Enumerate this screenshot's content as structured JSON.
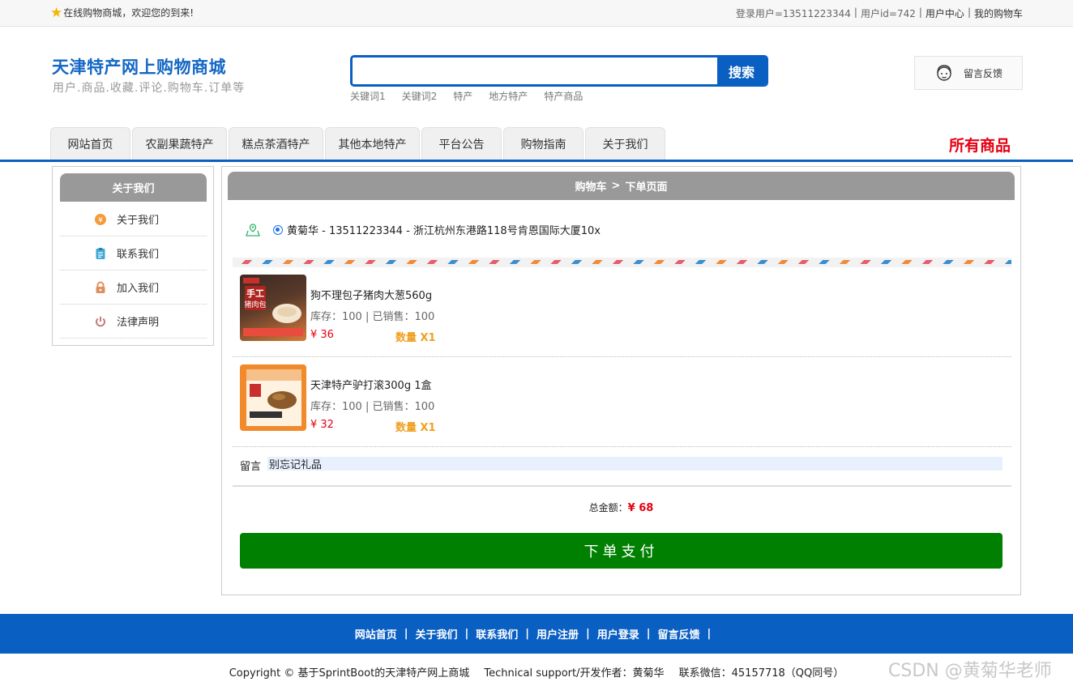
{
  "topbar": {
    "welcome": "在线购物商城，欢迎您的到来!",
    "login_user": "登录用户=13511223344",
    "user_id": "用户id=742",
    "user_center": "用户中心",
    "my_cart": "我的购物车",
    "separator": "|"
  },
  "header": {
    "title": "天津特产网上购物商城",
    "subtitle": "用户.商品.收藏.评论.购物车.订单等",
    "search_placeholder": "",
    "search_button": "搜索",
    "hot_words": [
      "关键词1",
      "关键词2",
      "特产",
      "地方特产",
      "特产商品"
    ],
    "feedback": "留言反馈"
  },
  "nav": {
    "items": [
      "网站首页",
      "农副果蔬特产",
      "糕点茶酒特产",
      "其他本地特产",
      "平台公告",
      "购物指南",
      "关于我们"
    ],
    "all_goods": "所有商品"
  },
  "sidebar": {
    "title": "关于我们",
    "items": [
      {
        "label": "关于我们",
        "icon": "coin-icon",
        "color": "#f39c3c"
      },
      {
        "label": "联系我们",
        "icon": "clipboard-icon",
        "color": "#3fa9d8"
      },
      {
        "label": "加入我们",
        "icon": "lock-icon",
        "color": "#e09060"
      },
      {
        "label": "法律声明",
        "icon": "power-icon",
        "color": "#c47a7a"
      }
    ]
  },
  "main": {
    "breadcrumb_cart": "购物车",
    "breadcrumb_sep": ">",
    "breadcrumb_page": "下单页面",
    "address": "黄菊华 - 13511223344 - 浙江杭州东港路118号肯恩国际大厦10x",
    "products": [
      {
        "name": "狗不理包子猪肉大葱560g",
        "stock": "库存：100 | 已销售：100",
        "price": "¥ 36",
        "qty": "数量 X1",
        "thumb_text": "手工 猪肉包"
      },
      {
        "name": "天津特产驴打滚300g 1盒",
        "stock": "库存：100 | 已销售：100",
        "price": "¥ 32",
        "qty": "数量 X1",
        "thumb_text": ""
      }
    ],
    "note_label": "留言",
    "note_value": "别忘记礼品",
    "total_label": "总金额：",
    "total_value": "¥ 68",
    "pay_button": "下单支付"
  },
  "footer": {
    "links": [
      "网站首页",
      "关于我们",
      "联系我们",
      "用户注册",
      "用户登录",
      "留言反馈"
    ],
    "separator": "|",
    "copyright": "Copyright © 基于SprintBoot的天津特产网上商城",
    "support": "Technical support/开发作者：黄菊华",
    "contact": "联系微信：45157718（QQ同号）",
    "watermark": "CSDN @黄菊华老师"
  },
  "colors": {
    "brand_blue": "#0a5fc2",
    "price_red": "#e60012",
    "qty_orange": "#f0a020",
    "pay_green": "#008000"
  }
}
